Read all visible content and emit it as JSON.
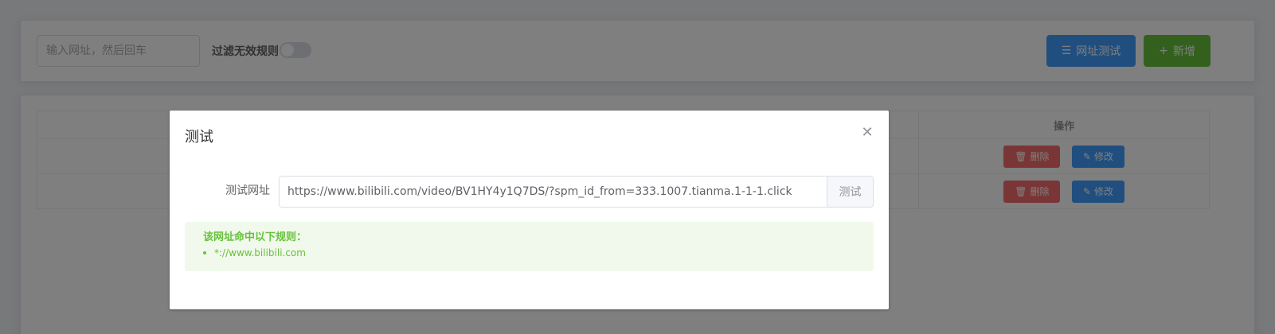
{
  "toolbar": {
    "search_placeholder": "输入网址，然后回车",
    "filter_label": "过滤无效规则",
    "filter_enabled": false,
    "test_url_button": "网址测试",
    "add_button": "新增"
  },
  "table": {
    "ops_header": "操作",
    "rows": [
      {
        "delete_label": "删除",
        "edit_label": "修改"
      },
      {
        "delete_label": "删除",
        "edit_label": "修改"
      }
    ]
  },
  "dialog": {
    "title": "测试",
    "close_icon": "close-icon",
    "url_label": "测试网址",
    "url_value": "https://www.bilibili.com/video/BV1HY4y1Q7DS/?spm_id_from=333.1007.tianma.1-1-1.click",
    "test_button": "测试",
    "result_title": "该网址命中以下规则：",
    "matched_rules": [
      "*://www.bilibili.com"
    ]
  },
  "colors": {
    "primary": "#409eff",
    "success": "#67c23a",
    "danger": "#f56c6c"
  }
}
